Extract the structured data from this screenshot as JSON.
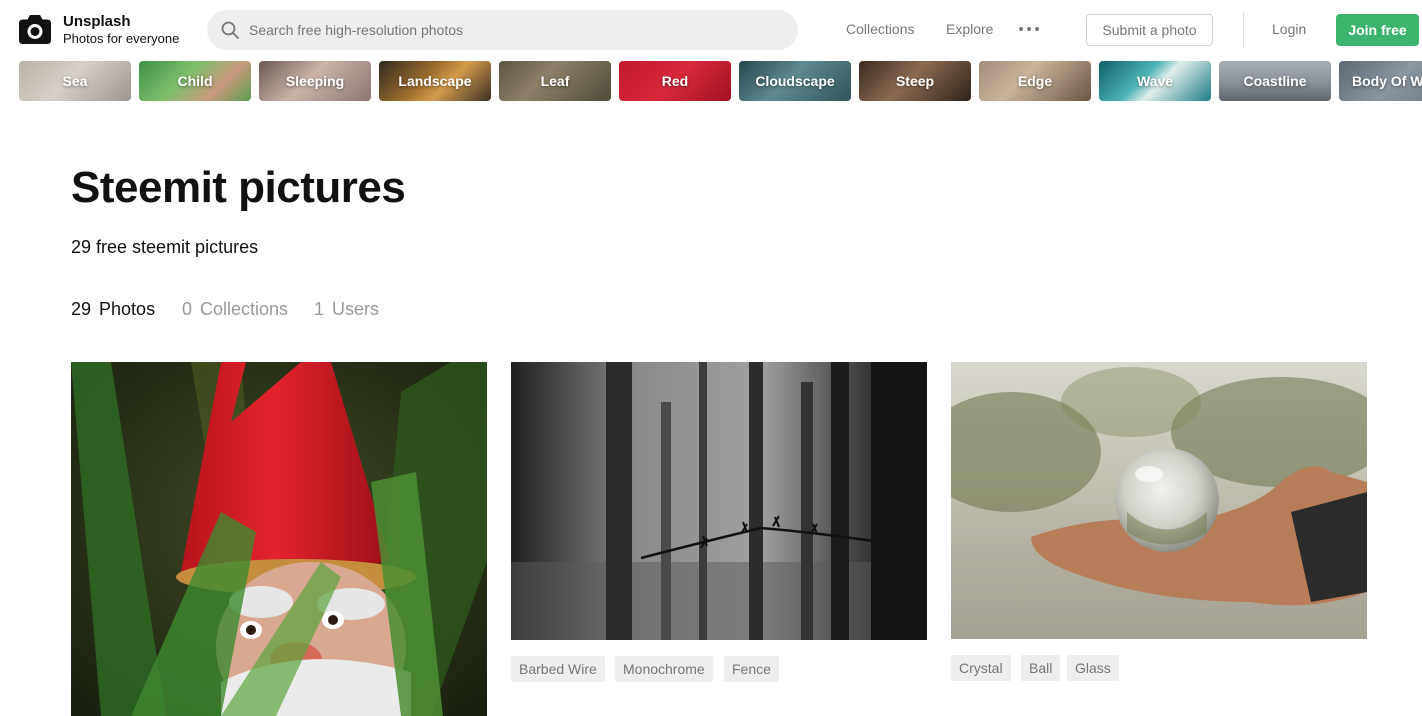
{
  "header": {
    "brand_title": "Unsplash",
    "brand_subtitle": "Photos for everyone",
    "search_placeholder": "Search free high-resolution photos",
    "nav": {
      "collections": "Collections",
      "explore": "Explore"
    },
    "submit_label": "Submit a photo",
    "login_label": "Login",
    "join_label": "Join free",
    "accent_color": "#3cb46e"
  },
  "topics": [
    {
      "label": "Sea"
    },
    {
      "label": "Child"
    },
    {
      "label": "Sleeping"
    },
    {
      "label": "Landscape"
    },
    {
      "label": "Leaf"
    },
    {
      "label": "Red"
    },
    {
      "label": "Cloudscape"
    },
    {
      "label": "Steep"
    },
    {
      "label": "Edge"
    },
    {
      "label": "Wave"
    },
    {
      "label": "Coastline"
    },
    {
      "label": "Body Of Water"
    }
  ],
  "page": {
    "title": "Steemit pictures",
    "subtitle": "29 free steemit pictures"
  },
  "tabs": [
    {
      "count": "29",
      "label": "Photos",
      "active": true
    },
    {
      "count": "0",
      "label": "Collections",
      "active": false
    },
    {
      "count": "1",
      "label": "Users",
      "active": false
    }
  ],
  "photos": [
    {
      "subject": "garden gnome in grass",
      "tags": []
    },
    {
      "subject": "barbed wire in forest",
      "tags": [
        "Barbed Wire",
        "Monochrome",
        "Fence"
      ]
    },
    {
      "subject": "hand holding crystal ball",
      "tags": [
        "Crystal",
        "Ball",
        "Glass"
      ]
    }
  ]
}
